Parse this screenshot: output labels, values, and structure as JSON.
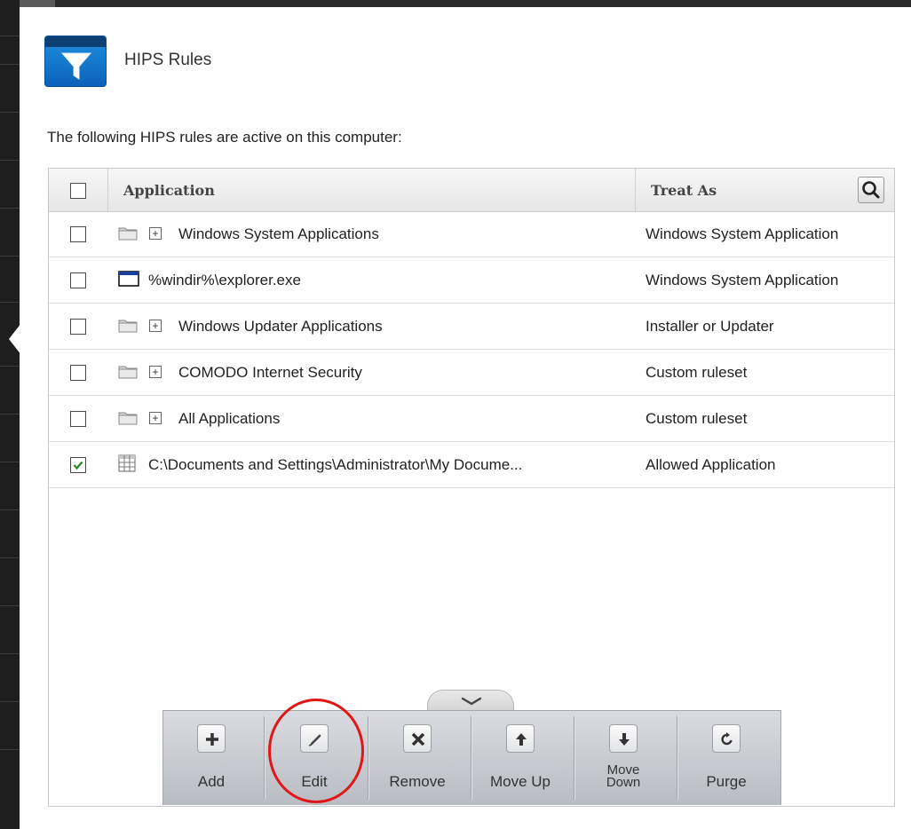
{
  "page": {
    "title": "HIPS Rules",
    "intro": "The following HIPS rules are active on this computer:"
  },
  "table": {
    "columns": {
      "application": "Application",
      "treat_as": "Treat As"
    },
    "rows": [
      {
        "application": "Windows System Applications",
        "treat_as": "Windows System Application",
        "checked": false,
        "icon": "folder-icon",
        "expandable": true
      },
      {
        "application": "%windir%\\explorer.exe",
        "treat_as": "Windows System Application",
        "checked": false,
        "icon": "application-window-icon",
        "expandable": false
      },
      {
        "application": "Windows Updater Applications",
        "treat_as": "Installer or Updater",
        "checked": false,
        "icon": "folder-icon",
        "expandable": true
      },
      {
        "application": "COMODO Internet Security",
        "treat_as": "Custom ruleset",
        "checked": false,
        "icon": "folder-icon",
        "expandable": true
      },
      {
        "application": "All Applications",
        "treat_as": "Custom ruleset",
        "checked": false,
        "icon": "folder-icon",
        "expandable": true
      },
      {
        "application": "C:\\Documents and Settings\\Administrator\\My Docume...",
        "treat_as": "Allowed Application",
        "checked": true,
        "icon": "spreadsheet-file-icon",
        "expandable": false
      }
    ]
  },
  "toolbar": {
    "add": "Add",
    "edit": "Edit",
    "remove": "Remove",
    "move_up": "Move Up",
    "move_down_1": "Move",
    "move_down_2": "Down",
    "purge": "Purge"
  },
  "colors": {
    "accent_blue": "#1a7fd4",
    "annotation_red": "#e11717",
    "check_green": "#1f8f1f"
  }
}
